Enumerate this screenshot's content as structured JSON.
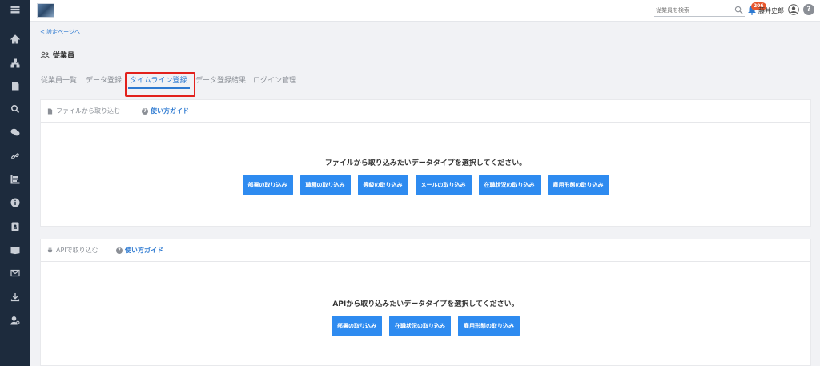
{
  "topbar": {
    "search_placeholder": "従業員を検索",
    "notification_count": "206",
    "user_name": "藤井史郎",
    "help_label": "?"
  },
  "sidebar": {
    "icons": [
      "menu-icon",
      "home-icon",
      "org-chart-icon",
      "document-icon",
      "search-icon",
      "chat-icon",
      "link-icon",
      "chart-icon",
      "info-icon",
      "contacts-icon",
      "book-icon",
      "mail-icon",
      "download-icon",
      "user-settings-icon"
    ]
  },
  "page": {
    "back_link": "< 設定ページへ",
    "title": "従業員"
  },
  "tabs": [
    {
      "label": "従業員一覧"
    },
    {
      "label": "データ登録"
    },
    {
      "label": "タイムライン登録"
    },
    {
      "label": "データ登録結果"
    },
    {
      "label": "ログイン管理"
    }
  ],
  "file_panel": {
    "header_label": "ファイルから取り込む",
    "guide_label": "使い方ガイド",
    "prompt": "ファイルから取り込みたいデータタイプを選択してください。",
    "buttons": [
      "部署の取り込み",
      "職種の取り込み",
      "等級の取り込み",
      "メールの取り込み",
      "在職状況の取り込み",
      "雇用形態の取り込み"
    ]
  },
  "api_panel": {
    "header_label": "APIで取り込む",
    "guide_label": "使い方ガイド",
    "prompt": "APIから取り込みたいデータタイプを選択してください。",
    "buttons": [
      "部署の取り込み",
      "在職状況の取り込み",
      "雇用形態の取り込み"
    ]
  },
  "colors": {
    "sidebar_bg": "#1d2b3d",
    "accent": "#2e7ad1",
    "button": "#2e8bf0",
    "highlight": "#e2211c",
    "badge": "#e8572d"
  }
}
